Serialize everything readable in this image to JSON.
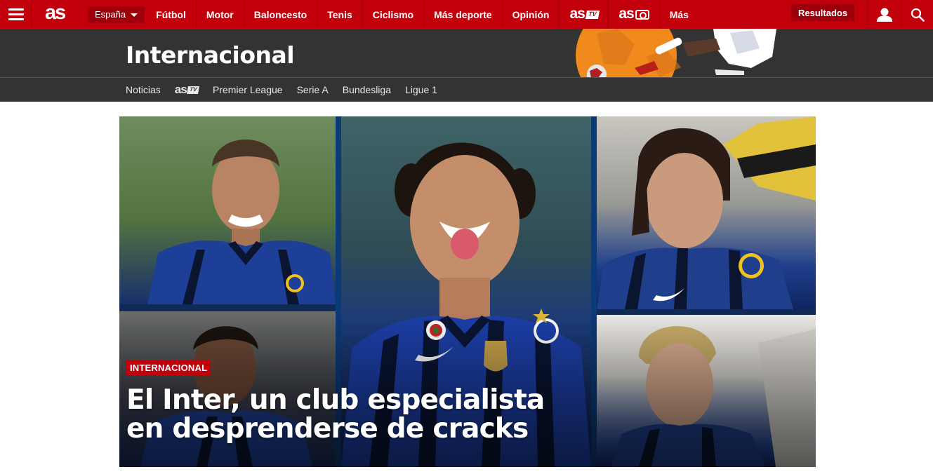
{
  "header": {
    "logo": "as",
    "region": "España",
    "nav": [
      "Fútbol",
      "Motor",
      "Baloncesto",
      "Tenis",
      "Ciclismo",
      "Más deporte",
      "Opinión"
    ],
    "as_tv_logo": "as",
    "as_tv_badge": "TV",
    "as_foto_logo": "as",
    "more": "Más",
    "results": "Resultados"
  },
  "section": {
    "title": "Internacional",
    "subnav": {
      "first": "Noticias",
      "astv_logo": "as",
      "astv_badge": "TV",
      "rest": [
        "Premier League",
        "Serie A",
        "Bundesliga",
        "Ligue 1"
      ]
    }
  },
  "hero": {
    "tag": "INTERNACIONAL",
    "title": "El Inter, un club especialista en desprenderse de cracks"
  },
  "colors": {
    "brand_red": "#c2000b",
    "section_bg": "#333333",
    "inter_blue": "#1c3a7a"
  }
}
